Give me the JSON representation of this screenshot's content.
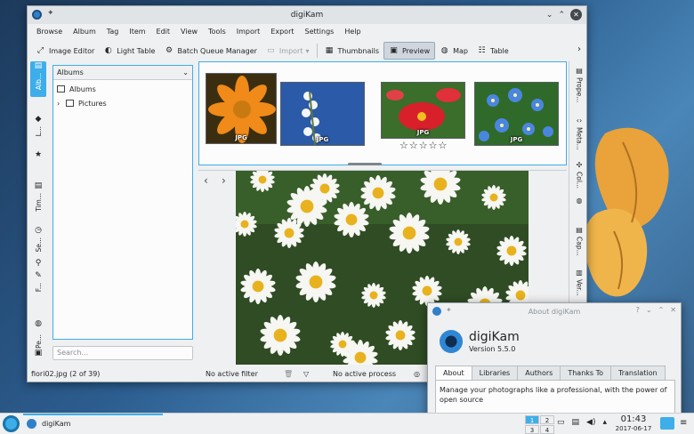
{
  "window": {
    "title": "digiKam",
    "menu": [
      "Browse",
      "Album",
      "Tag",
      "Item",
      "Edit",
      "View",
      "Tools",
      "Import",
      "Export",
      "Settings",
      "Help"
    ]
  },
  "toolbar": {
    "image_editor": "Image Editor",
    "light_table": "Light Table",
    "batch_queue": "Batch Queue Manager",
    "import": "Import",
    "thumbnails": "Thumbnails",
    "preview": "Preview",
    "map": "Map",
    "table": "Table"
  },
  "left_tabs": [
    "Alb...",
    "L...",
    "Tim...",
    "Se...",
    "F...",
    "Pe..."
  ],
  "albums_panel": {
    "header": "Albums",
    "root": "Albums",
    "child": "Pictures",
    "search_placeholder": "Search..."
  },
  "thumbnails": [
    {
      "label": "JPG",
      "colors": [
        "#f08a18",
        "#3b2e10"
      ]
    },
    {
      "label": "JPG",
      "colors": [
        "#2a5aa8",
        "#ffffff"
      ]
    },
    {
      "label": "JPG",
      "colors": [
        "#d8202a",
        "#3a6e2a"
      ]
    },
    {
      "label": "JPG",
      "colors": [
        "#3c78d8",
        "#2f6a2a"
      ]
    }
  ],
  "rating_stars": "☆☆☆☆☆",
  "right_tabs": [
    "Prope...",
    "Meta...",
    "Col...",
    "Cap...",
    "Ver..."
  ],
  "status": {
    "file": "fiori02.jpg (2 of 39)",
    "filter": "No active filter",
    "process": "No active process"
  },
  "about": {
    "title": "About digiKam",
    "app_name": "digiKam",
    "version": "Version 5.5.0",
    "tabs": [
      "About",
      "Libraries",
      "Authors",
      "Thanks To",
      "Translation"
    ],
    "text": "Manage your photographs like a professional, with the power of open source"
  },
  "taskbar": {
    "task": "digiKam",
    "pager": [
      "1",
      "2",
      "3",
      "4"
    ],
    "time": "01:43",
    "date": "2017-06-17"
  }
}
